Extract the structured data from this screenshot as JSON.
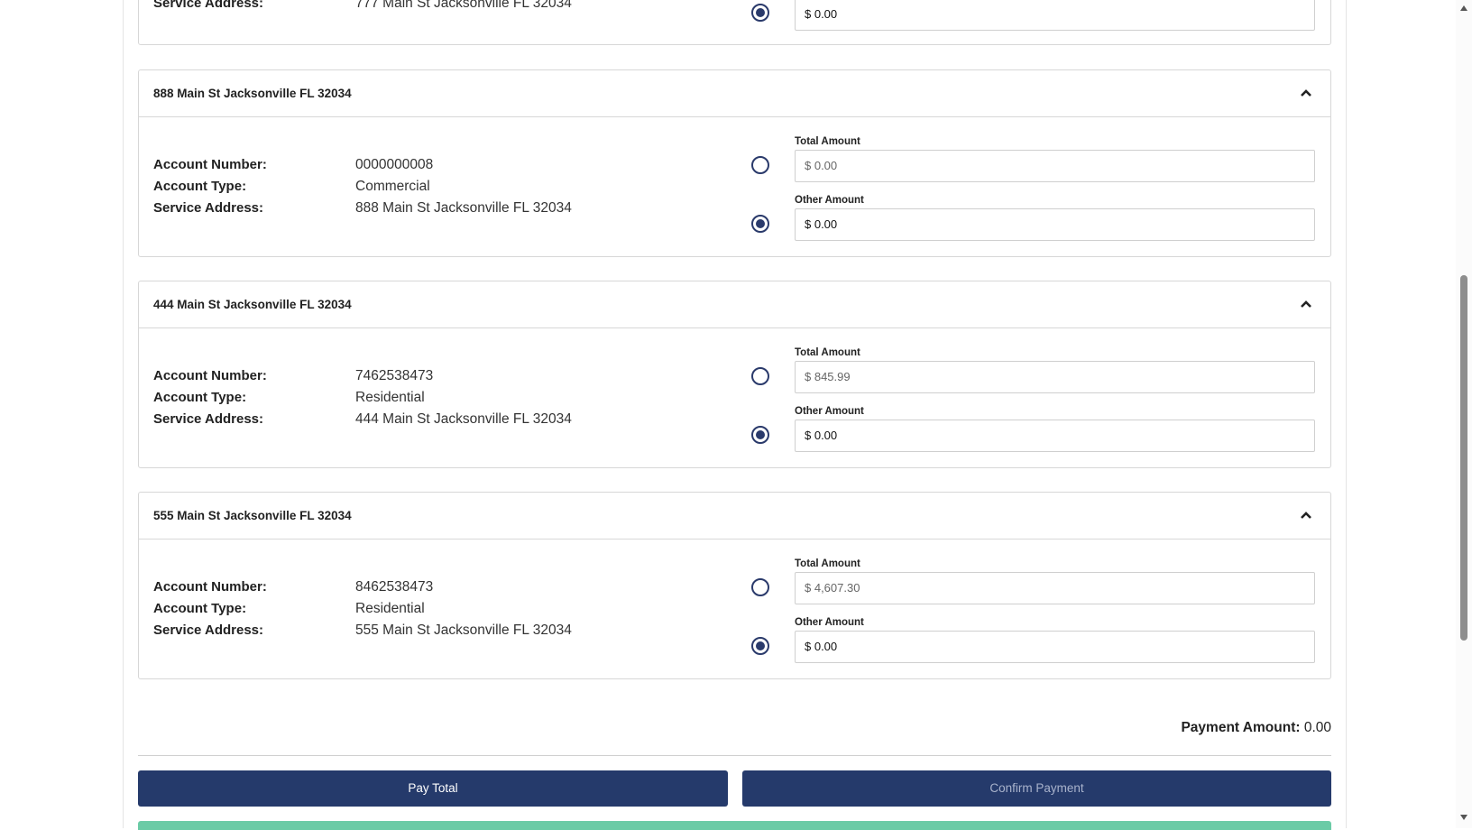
{
  "top_partial": {
    "label": "Service Address:",
    "value": "777 Main St Jacksonville FL 32034",
    "other_amount_value": "$ 0.00"
  },
  "cards": [
    {
      "title": "888 Main St Jacksonville FL 32034",
      "account_number_label": "Account Number:",
      "account_number": "0000000008",
      "account_type_label": "Account Type:",
      "account_type": "Commercial",
      "service_address_label": "Service Address:",
      "service_address": "888 Main St Jacksonville FL 32034",
      "total_amount_label": "Total Amount",
      "total_amount_value": "$ 0.00",
      "other_amount_label": "Other Amount",
      "other_amount_value": "$ 0.00",
      "selected_option": "other"
    },
    {
      "title": "444 Main St Jacksonville FL 32034",
      "account_number_label": "Account Number:",
      "account_number": "7462538473",
      "account_type_label": "Account Type:",
      "account_type": "Residential",
      "service_address_label": "Service Address:",
      "service_address": "444 Main St Jacksonville FL 32034",
      "total_amount_label": "Total Amount",
      "total_amount_value": "$ 845.99",
      "other_amount_label": "Other Amount",
      "other_amount_value": "$ 0.00",
      "selected_option": "other"
    },
    {
      "title": "555 Main St Jacksonville FL 32034",
      "account_number_label": "Account Number:",
      "account_number": "8462538473",
      "account_type_label": "Account Type:",
      "account_type": "Residential",
      "service_address_label": "Service Address:",
      "service_address": "555 Main St Jacksonville FL 32034",
      "total_amount_label": "Total Amount",
      "total_amount_value": "$ 4,607.30",
      "other_amount_label": "Other Amount",
      "other_amount_value": "$ 0.00",
      "selected_option": "other"
    }
  ],
  "summary": {
    "payment_amount_label": "Payment Amount:",
    "payment_amount_value": "0.00"
  },
  "buttons": {
    "pay_total": "Pay Total",
    "confirm_payment": "Confirm Payment"
  },
  "colors": {
    "primary": "#253a6b",
    "success_bar": "#6bcba6"
  }
}
